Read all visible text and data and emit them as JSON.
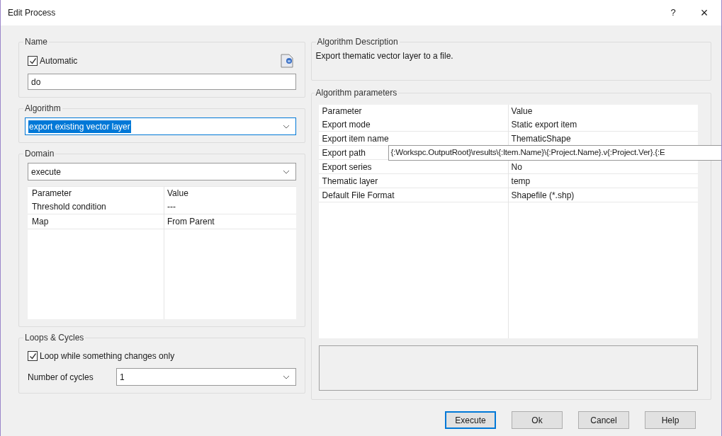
{
  "window": {
    "title": "Edit Process",
    "help": "?",
    "close": "×"
  },
  "name_group": {
    "label": "Name",
    "automatic": {
      "label": "Automatic",
      "checked": true
    },
    "value": "do"
  },
  "algorithm_group": {
    "label": "Algorithm",
    "value": "export existing vector layer",
    "selected": true
  },
  "domain_group": {
    "label": "Domain",
    "value": "execute",
    "table": {
      "columns": [
        "Parameter",
        "Value"
      ],
      "rows": [
        {
          "parameter": "Threshold condition",
          "value": "---"
        },
        {
          "parameter": "Map",
          "value": "From Parent"
        }
      ]
    }
  },
  "loops_group": {
    "label": "Loops & Cycles",
    "loop_option": {
      "label": "Loop while something changes only",
      "checked": true
    },
    "cycles_label": "Number of cycles",
    "cycles_value": "1"
  },
  "description_group": {
    "label": "Algorithm Description",
    "text": "Export thematic vector layer to a file."
  },
  "parameters_group": {
    "label": "Algorithm parameters",
    "table": {
      "columns": [
        "Parameter",
        "Value"
      ],
      "rows": [
        {
          "parameter": "Export mode",
          "value": "Static export item",
          "kind": "text"
        },
        {
          "parameter": "Export item name",
          "value": "ThematicShape",
          "kind": "text"
        },
        {
          "parameter": "Export path",
          "value": "{:Workspc.OutputRoot}\\results\\{:Item.Name}\\{:Project.Name}.v{:Project.Ver}.{:E",
          "kind": "edit"
        },
        {
          "parameter": "Export series",
          "value": "No",
          "kind": "text"
        },
        {
          "parameter": "Thematic layer",
          "value": "temp",
          "kind": "text"
        },
        {
          "parameter": "Default File Format",
          "value": "Shapefile (*.shp)",
          "kind": "text"
        }
      ]
    }
  },
  "buttons": [
    {
      "label": "Execute",
      "default": true
    },
    {
      "label": "Ok",
      "default": false
    },
    {
      "label": "Cancel",
      "default": false
    },
    {
      "label": "Help",
      "default": false
    }
  ]
}
